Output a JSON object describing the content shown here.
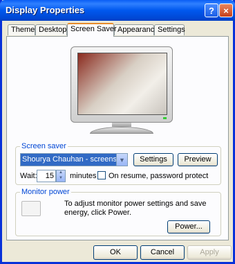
{
  "window": {
    "title": "Display Properties",
    "help_label": "?",
    "close_label": "×"
  },
  "tabs": [
    {
      "label": "Themes"
    },
    {
      "label": "Desktop"
    },
    {
      "label": "Screen Saver"
    },
    {
      "label": "Appearance"
    },
    {
      "label": "Settings"
    }
  ],
  "screen_saver": {
    "group_label": "Screen saver",
    "selected": "Shourya Chauhan - screensave",
    "settings_label": "Settings",
    "preview_label": "Preview",
    "wait_label": "Wait:",
    "wait_value": "15",
    "minutes_label": "minutes",
    "password_label": "On resume, password protect",
    "password_checked": false
  },
  "monitor_power": {
    "group_label": "Monitor power",
    "description": "To adjust monitor power settings and save energy, click Power.",
    "power_label": "Power..."
  },
  "footer": {
    "ok_label": "OK",
    "cancel_label": "Cancel",
    "apply_label": "Apply"
  },
  "colors": {
    "titlebar": "#0058ee",
    "group_label": "#0046d5",
    "selection": "#316ac5"
  }
}
